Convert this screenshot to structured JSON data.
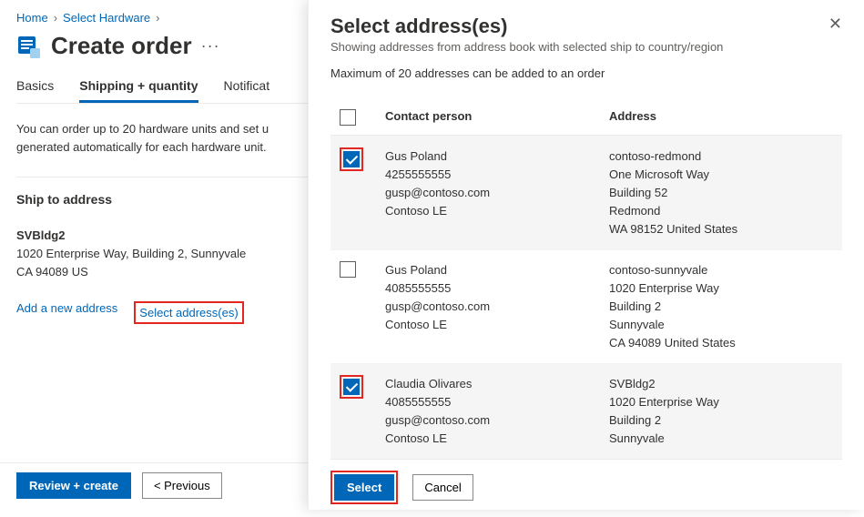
{
  "breadcrumb": {
    "home": "Home",
    "hw": "Select Hardware"
  },
  "page": {
    "title": "Create order"
  },
  "tabs": {
    "basics": "Basics",
    "shipping": "Shipping + quantity",
    "notif": "Notificat"
  },
  "intro": "You can order up to 20 hardware units and set u generated automatically for each hardware unit.",
  "ship": {
    "heading": "Ship to address",
    "name": "SVBldg2",
    "line1": "1020 Enterprise Way, Building 2, Sunnyvale",
    "line2": "CA 94089 US",
    "add": "Add a new address",
    "select": "Select address(es)"
  },
  "footer": {
    "review": "Review + create",
    "prev": "< Previous"
  },
  "panel": {
    "title": "Select address(es)",
    "sub": "Showing addresses from address book with selected ship to country/region",
    "note": "Maximum of 20 addresses can be added to an order",
    "col_contact": "Contact person",
    "col_address": "Address",
    "select": "Select",
    "cancel": "Cancel",
    "rows": [
      {
        "checked": true,
        "shaded": true,
        "red": true,
        "contact": [
          "Gus Poland",
          "4255555555",
          "gusp@contoso.com",
          "Contoso LE"
        ],
        "address": [
          "contoso-redmond",
          "One Microsoft Way",
          "Building 52",
          "Redmond",
          "WA 98152 United States"
        ]
      },
      {
        "checked": false,
        "shaded": false,
        "red": false,
        "contact": [
          "Gus Poland",
          "4085555555",
          "gusp@contoso.com",
          "Contoso LE"
        ],
        "address": [
          "contoso-sunnyvale",
          "1020 Enterprise Way",
          "Building 2",
          "Sunnyvale",
          "CA 94089 United States"
        ]
      },
      {
        "checked": true,
        "shaded": true,
        "red": true,
        "contact": [
          "Claudia Olivares",
          "4085555555",
          "gusp@contoso.com",
          "Contoso LE"
        ],
        "address": [
          "SVBldg2",
          "1020 Enterprise Way",
          "Building 2",
          "Sunnyvale"
        ]
      }
    ]
  }
}
